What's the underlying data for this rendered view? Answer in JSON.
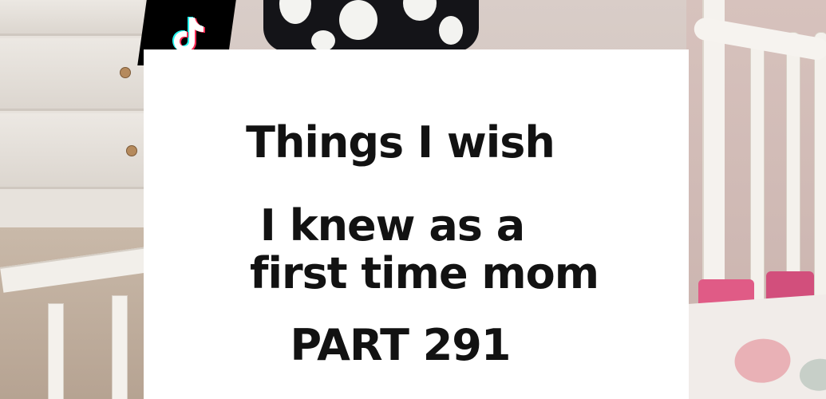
{
  "overlay": {
    "logo_icon": "tiktok-note-icon",
    "caption_lines": [
      "Things I wish",
      "I knew as a",
      "first time mom",
      "PART 291"
    ]
  },
  "colors": {
    "card_background": "#ffffff",
    "caption_text": "#121212",
    "logo_background": "#000000"
  }
}
